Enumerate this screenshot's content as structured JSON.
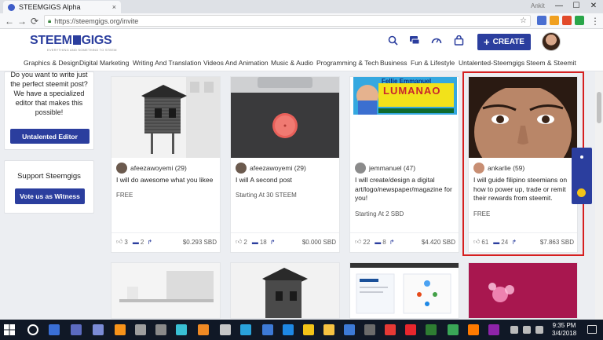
{
  "browser": {
    "tab_title": "STEEMGIGS Alpha",
    "tab_close": "×",
    "profile_name": "Ankit",
    "url": "https://steemgigs.org/invite",
    "minimize": "—",
    "maximize": "☐",
    "close": "✕"
  },
  "header": {
    "logo_left": "STEEM",
    "logo_right": "GIGS",
    "logo_tagline": "EVERYTHING AND SOMETHING TO STEEM",
    "create_label": "CREATE",
    "create_icon": "+"
  },
  "categories": [
    "Graphics & Design",
    "Digital Marketing",
    "Writing And Translation",
    "Videos And Animation",
    "Music & Audio",
    "Programming & Tech",
    "Business",
    "Fun & Lifestyle",
    "Untalented-Steemgigs",
    "Steem & Steemit"
  ],
  "sidebar": {
    "editor_text": [
      "Do you want to write just",
      "the perfect steemit post?",
      "We have a specialized",
      "editor that makes this",
      "possible!"
    ],
    "editor_button": "Untalented Editor",
    "support_title": "Support Steemgigs",
    "witness_button": "Vote us as Witness"
  },
  "cards": [
    {
      "seller": "afeezawoyemi (29)",
      "title": "I will do awesome what you likee",
      "price": "FREE",
      "likes": "3",
      "comments": "2",
      "amount": "$0.293 SBD",
      "image": "cabin-photo"
    },
    {
      "seller": "afeezawoyemi (29)",
      "title": "I will A second post",
      "price": "Starting At 30 STEEM",
      "likes": "2",
      "comments": "18",
      "amount": "$0.000 SBD",
      "image": "speaker-photo"
    },
    {
      "seller": "jemmanuel (47)",
      "title": "I will create/design a digital art/logo/newspaper/magazine for you!",
      "price": "Starting At 2 SBD",
      "likes": "22",
      "comments": "8",
      "amount": "$4.420 SBD",
      "image": "banner-photo",
      "banner_name_top": "Fellie Emmanuel",
      "banner_name_bottom": "LUMANAO"
    },
    {
      "seller": "ankarlie (59)",
      "title": "I will guide filipino steemians on how to power up, trade or remit their rewards from steemit.",
      "price": "FREE",
      "likes": "61",
      "comments": "24",
      "amount": "$7.863 SBD",
      "image": "face-photo"
    }
  ],
  "taskbar": {
    "time": "9:35 PM",
    "date": "3/4/2018"
  },
  "colors": {
    "brand": "#2b3e9e",
    "highlight": "#d61f1f"
  }
}
